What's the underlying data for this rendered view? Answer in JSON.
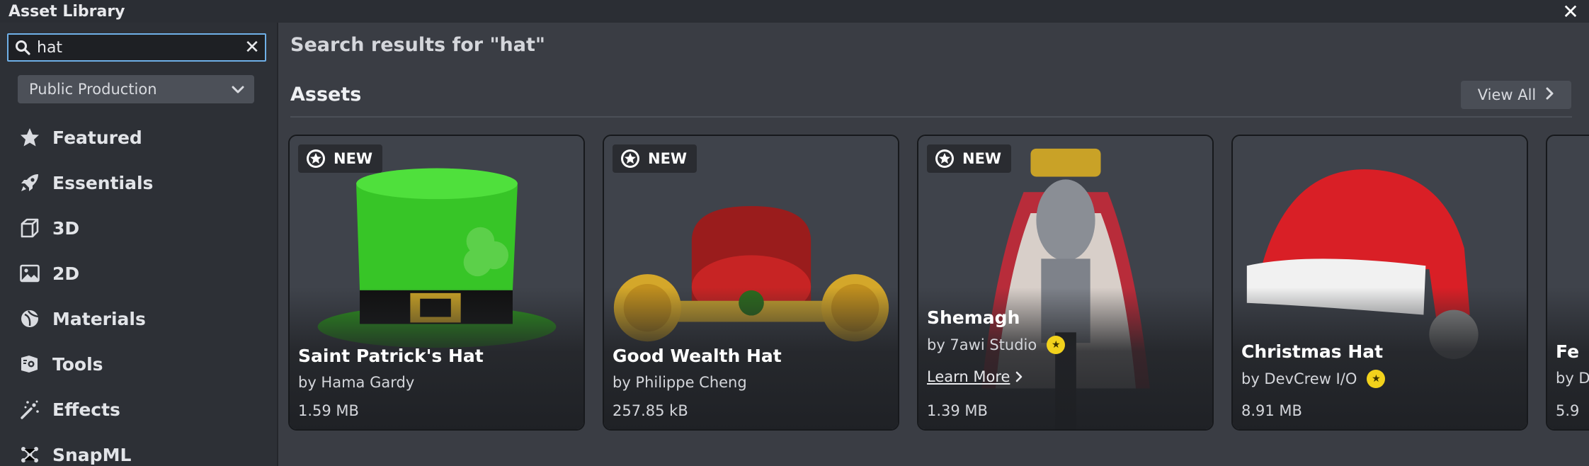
{
  "window": {
    "title": "Asset Library"
  },
  "search": {
    "value": "hat"
  },
  "source_dropdown": {
    "selected": "Public Production"
  },
  "nav": [
    {
      "label": "Featured",
      "icon": "star-icon"
    },
    {
      "label": "Essentials",
      "icon": "rocket-icon"
    },
    {
      "label": "3D",
      "icon": "cube-icon"
    },
    {
      "label": "2D",
      "icon": "image-icon"
    },
    {
      "label": "Materials",
      "icon": "materials-icon"
    },
    {
      "label": "Tools",
      "icon": "tools-icon"
    },
    {
      "label": "Effects",
      "icon": "effects-icon"
    },
    {
      "label": "SnapML",
      "icon": "snapml-icon"
    }
  ],
  "main": {
    "results_title": "Search results for \"hat\"",
    "section_title": "Assets",
    "view_all_label": "View All"
  },
  "assets": [
    {
      "name": "Saint Patrick's Hat",
      "author": "by Hama Gardy",
      "size": "1.59 MB",
      "badge": "NEW",
      "verified": false
    },
    {
      "name": "Good Wealth Hat",
      "author": "by Philippe Cheng",
      "size": "257.85 kB",
      "badge": "NEW",
      "verified": false
    },
    {
      "name": "Shemagh",
      "author": "by 7awi Studio",
      "size": "1.39 MB",
      "badge": "NEW",
      "verified": true,
      "learn_more": "Learn More"
    },
    {
      "name": "Christmas Hat",
      "author": "by DevCrew I/O",
      "size": "8.91 MB",
      "badge": "",
      "verified": true
    },
    {
      "name": "Fe",
      "author": "by D",
      "size": "5.9",
      "badge": "",
      "verified": false
    }
  ],
  "colors": {
    "accent_focus": "#6fb0e8",
    "verified_badge": "#f2d21c",
    "panel_bg": "#3a3d44",
    "sidebar_bg": "#2d3036"
  }
}
